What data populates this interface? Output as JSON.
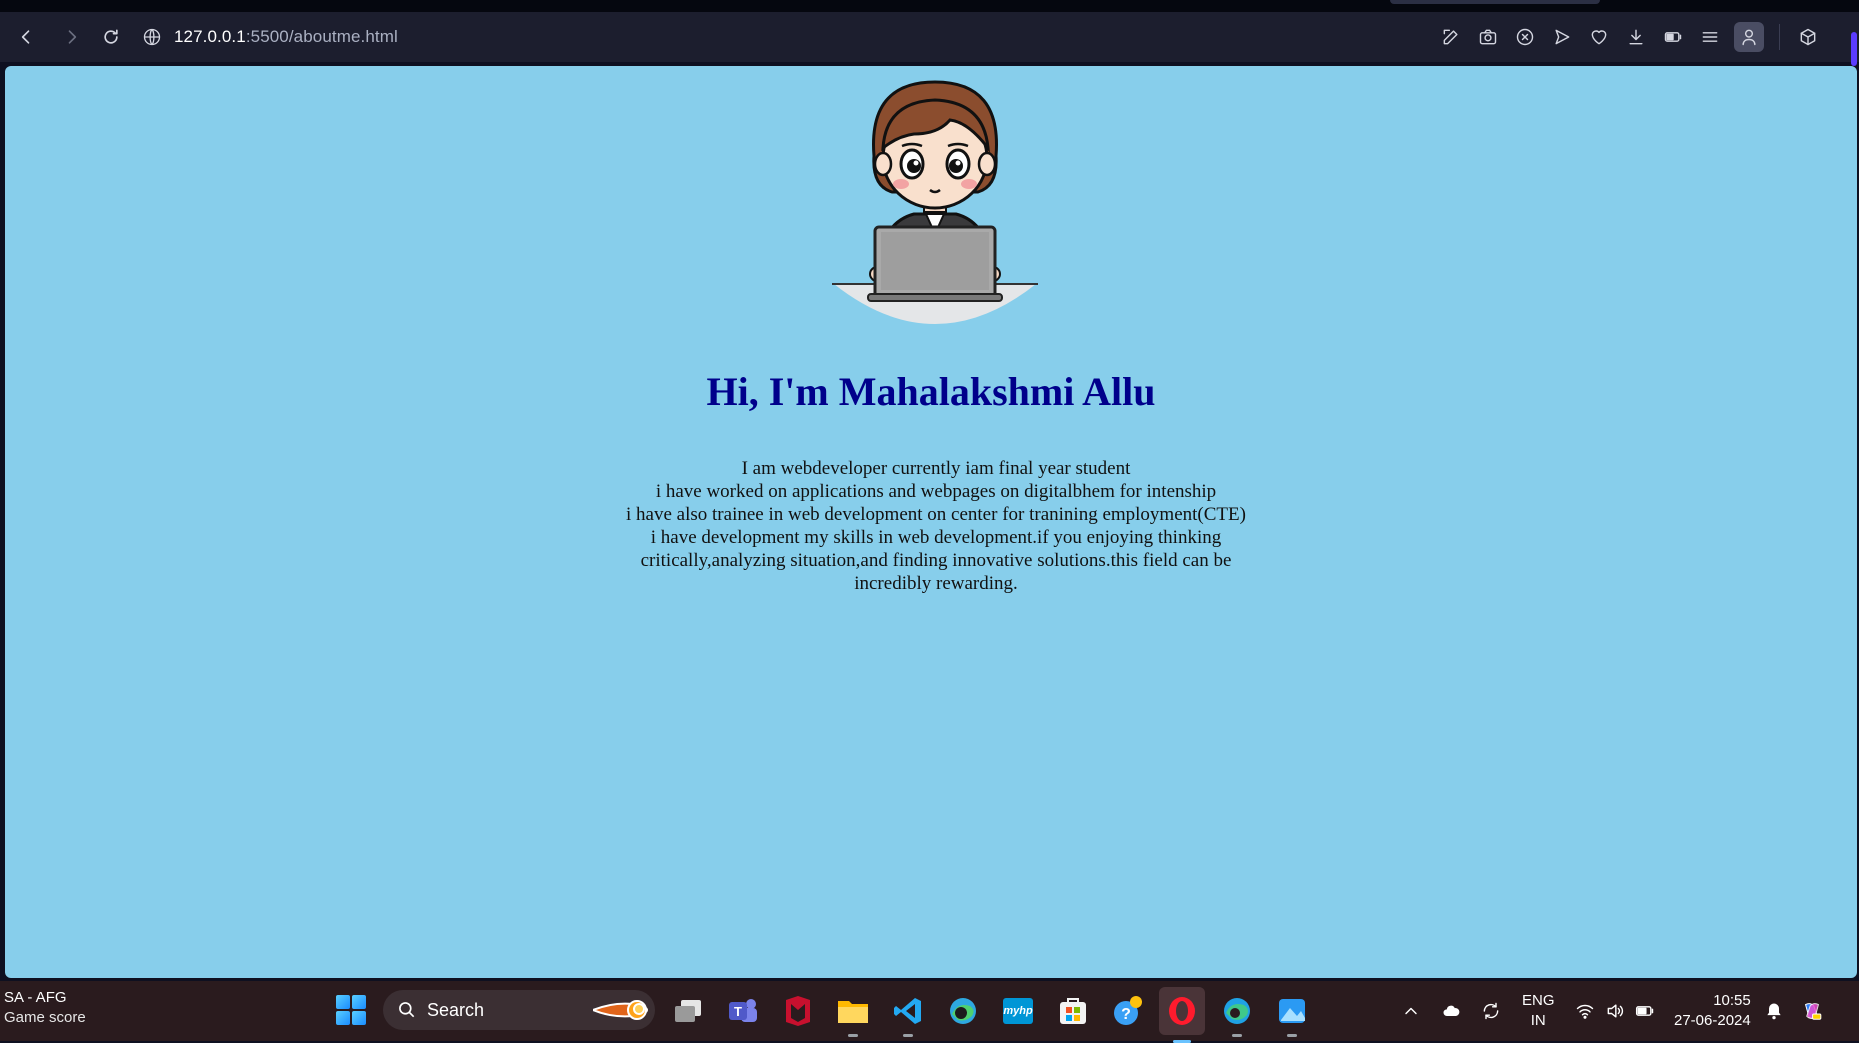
{
  "browser": {
    "url_host": "127.0.0.1",
    "url_rest": ":5500/aboutme.html"
  },
  "page": {
    "background": "#87ceeb",
    "avatar_alt": "Girl working on laptop",
    "title": "Hi, I'm Mahalakshmi Allu",
    "title_color": "#00008b",
    "bio_lines": [
      "I am webdeveloper currently iam final year student",
      "i have worked on applications and webpages on digitalbhem for intenship",
      "i have also trainee in web development on center for tranining employment(CTE)",
      "i have development my skills in web development.if you enjoying thinking critically,analyzing situation,and finding innovative solutions.this field can be incredibly rewarding."
    ]
  },
  "taskbar": {
    "widget_title": "SA - AFG",
    "widget_sub": "Game score",
    "search_label": "Search",
    "apps": [
      "task-view",
      "teams",
      "mcafee",
      "file-explorer",
      "vscode",
      "edge-dev",
      "myhp",
      "microsoft-store",
      "get-help",
      "opera",
      "edge",
      "photos"
    ],
    "myhp_label": "myhp",
    "lang_top": "ENG",
    "lang_bottom": "IN",
    "time": "10:55",
    "date": "27-06-2024"
  }
}
